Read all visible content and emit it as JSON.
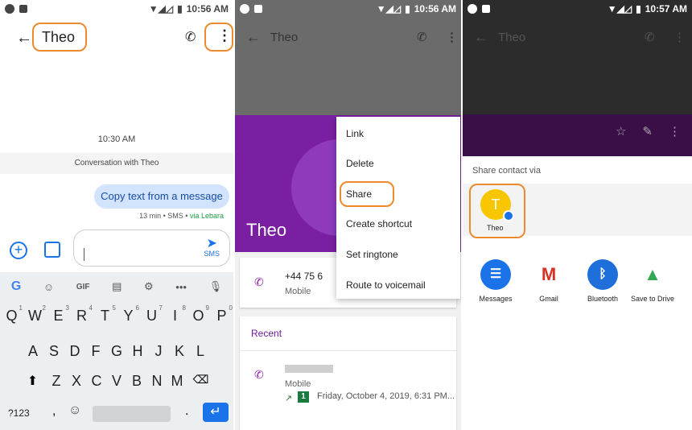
{
  "panel1": {
    "status_time": "10:56 AM",
    "title": "Theo",
    "timestamp": "10:30 AM",
    "conversation_label": "Conversation with Theo",
    "message": "Copy text from a message",
    "meta": "13 min • SMS • ",
    "via": "via Lebara",
    "send_label": "SMS",
    "keyboard": {
      "toolbar_gif": "GIF",
      "row1": [
        "Q",
        "W",
        "E",
        "R",
        "T",
        "Y",
        "U",
        "I",
        "O",
        "P"
      ],
      "row1_nums": [
        "1",
        "2",
        "3",
        "4",
        "5",
        "6",
        "7",
        "8",
        "9",
        "0"
      ],
      "row2": [
        "A",
        "S",
        "D",
        "F",
        "G",
        "H",
        "J",
        "K",
        "L"
      ],
      "row3": [
        "Z",
        "X",
        "C",
        "V",
        "B",
        "N",
        "M"
      ],
      "num_key": "?123",
      "comma": ",",
      "period": "."
    }
  },
  "panel2": {
    "status_time": "10:56 AM",
    "title": "Theo",
    "contact_name": "Theo",
    "phone_number": "+44 75 6",
    "phone_type": "Mobile",
    "recent_label": "Recent",
    "recent_type": "Mobile",
    "recent_sim": "1",
    "recent_date": "Friday, October 4, 2019, 6:31 PM...",
    "menu": [
      "Link",
      "Delete",
      "Share",
      "Create shortcut",
      "Set ringtone",
      "Route to voicemail"
    ]
  },
  "panel3": {
    "status_time": "10:57 AM",
    "title": "Theo",
    "sheet_title": "Share contact via",
    "direct_initial": "T",
    "direct_name": "Theo",
    "apps": [
      {
        "label": "Messages",
        "color": "#1a73e8"
      },
      {
        "label": "Gmail",
        "color": "#ffffff"
      },
      {
        "label": "Bluetooth",
        "color": "#1e6fd9"
      },
      {
        "label": "Save to Drive",
        "color": "#ffffff"
      }
    ]
  },
  "colors": {
    "highlight": "#ec8a2e",
    "accent_blue": "#1a73e8",
    "contact_purple": "#7b1fa2"
  }
}
